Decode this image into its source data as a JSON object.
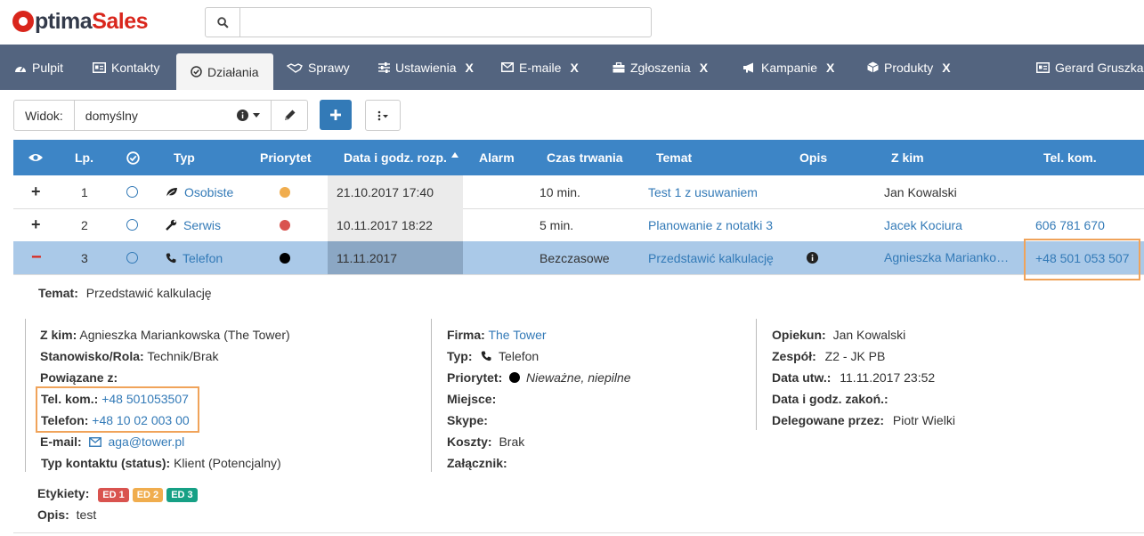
{
  "app": {
    "logo_part1": "ptima",
    "logo_part2": "Sales"
  },
  "search": {
    "placeholder": "",
    "value": ""
  },
  "nav": {
    "pulpit": "Pulpit",
    "kontakty": "Kontakty",
    "dzialania": "Działania",
    "sprawy": "Sprawy",
    "ustawienia": "Ustawienia",
    "emaile": "E-maile",
    "zgloszenia": "Zgłoszenia",
    "kampanie": "Kampanie",
    "produkty": "Produkty",
    "close": "X",
    "user": "Gerard Gruszka"
  },
  "toolbar": {
    "view_label": "Widok:",
    "view_value": "domyślny"
  },
  "table": {
    "headers": {
      "lp": "Lp.",
      "typ": "Typ",
      "priorytet": "Priorytet",
      "data": "Data i godz. rozp.",
      "alarm": "Alarm",
      "czas": "Czas trwania",
      "temat": "Temat",
      "opis": "Opis",
      "zkim": "Z kim",
      "tel": "Tel. kom."
    },
    "rows": [
      {
        "expand": "+",
        "lp": "1",
        "typ": "Osobiste",
        "priority_color": "#f0ad4e",
        "data": "21.10.2017 17:40",
        "czas": "10 min.",
        "temat": "Test 1 z usuwaniem",
        "zkim": "Jan Kowalski",
        "tel": ""
      },
      {
        "expand": "+",
        "lp": "2",
        "typ": "Serwis",
        "priority_color": "#d9534f",
        "data": "10.11.2017 18:22",
        "czas": "5 min.",
        "temat": "Planowanie z notatki 3",
        "zkim": "Jacek Kociura",
        "tel": "606 781 670"
      },
      {
        "expand": "−",
        "lp": "3",
        "typ": "Telefon",
        "priority_color": "#000000",
        "data": "11.11.2017",
        "czas": "Bezczasowe",
        "temat": "Przedstawić kalkulację",
        "zkim": "Agnieszka Mariankowska",
        "tel": "+48 501 053 507"
      }
    ]
  },
  "details": {
    "temat_label": "Temat:",
    "temat": "Przedstawić kalkulację",
    "col1": {
      "zkim_label": "Z kim:",
      "zkim": "Agnieszka Mariankowska (The Tower)",
      "stanowisko_label": "Stanowisko/Rola:",
      "stanowisko": "Technik/Brak",
      "powiazane_label": "Powiązane z:",
      "telkom_label": "Tel. kom.:",
      "telkom": "+48 501053507",
      "telefon_label": "Telefon:",
      "telefon": "+48 10 02 003 00",
      "email_label": "E-mail:",
      "email": "aga@tower.pl",
      "typkontaktu_label": "Typ kontaktu (status):",
      "typkontaktu": "Klient (Potencjalny)"
    },
    "col2": {
      "firma_label": "Firma:",
      "firma": "The Tower",
      "typ_label": "Typ:",
      "typ": "Telefon",
      "priorytet_label": "Priorytet:",
      "priorytet": "Nieważne, niepilne",
      "miejsce_label": "Miejsce:",
      "skype_label": "Skype:",
      "koszty_label": "Koszty:",
      "koszty": "Brak",
      "zalacznik_label": "Załącznik:"
    },
    "col3": {
      "opiekun_label": "Opiekun:",
      "opiekun": "Jan Kowalski",
      "zespol_label": "Zespół:",
      "zespol": "Z2 - JK PB",
      "datautw_label": "Data utw.:",
      "datautw": "11.11.2017 23:52",
      "datazak_label": "Data i godz. zakoń.:",
      "delegowane_label": "Delegowane przez:",
      "delegowane": "Piotr Wielki"
    },
    "etykiety_label": "Etykiety:",
    "tags": [
      {
        "text": "ED 1",
        "color": "#d9534f"
      },
      {
        "text": "ED 2",
        "color": "#f0ad4e"
      },
      {
        "text": "ED 3",
        "color": "#16a085"
      }
    ],
    "opis_label": "Opis:",
    "opis": "test"
  },
  "colors": {
    "nav_bg": "#53647f",
    "header_bg": "#3d85c6",
    "selected_row": "#aac9e8",
    "highlight": "#f0a35a",
    "link": "#337ab7"
  }
}
